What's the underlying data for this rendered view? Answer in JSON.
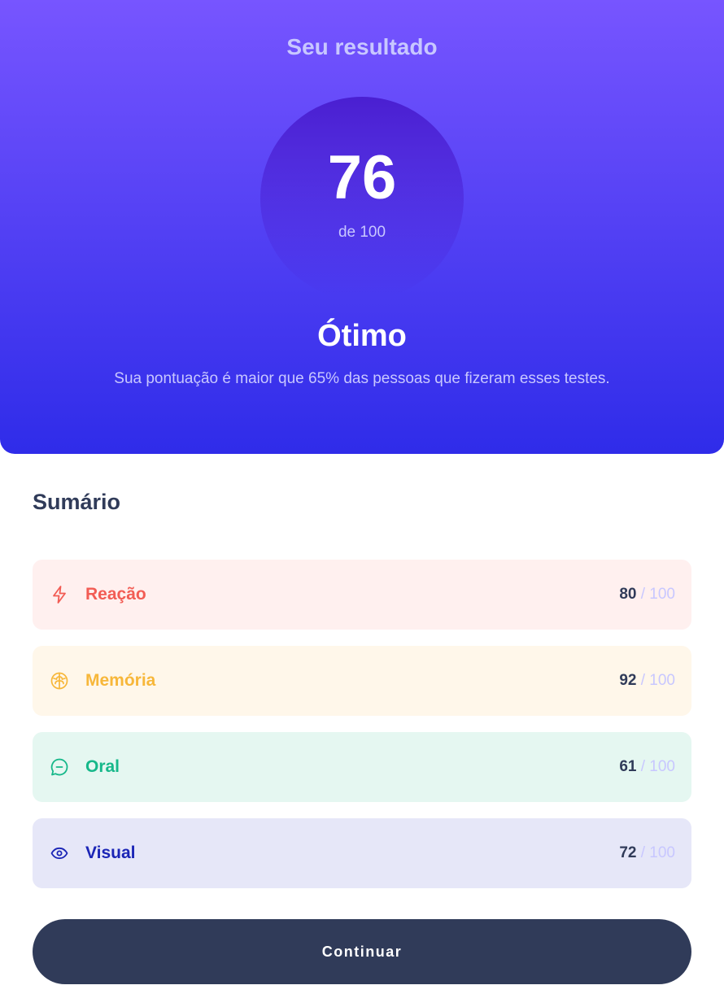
{
  "result": {
    "title": "Seu resultado",
    "score": "76",
    "max": "de 100",
    "grade": "Ótimo",
    "description": "Sua pontuação é maior que 65% das pessoas que fizeram esses testes."
  },
  "summary": {
    "title": "Sumário",
    "items": [
      {
        "label": "Reação",
        "score": "80",
        "separator": "/",
        "max": "100",
        "icon": "lightning-icon",
        "color": "#f25c54",
        "background": "#fff0ef"
      },
      {
        "label": "Memória",
        "score": "92",
        "separator": "/",
        "max": "100",
        "icon": "brain-icon",
        "color": "#f7b73a",
        "background": "#fff7ea"
      },
      {
        "label": "Oral",
        "score": "61",
        "separator": "/",
        "max": "100",
        "icon": "chat-bubble-icon",
        "color": "#16b88a",
        "background": "#e5f7f1"
      },
      {
        "label": "Visual",
        "score": "72",
        "separator": "/",
        "max": "100",
        "icon": "eye-icon",
        "color": "#1b25b6",
        "background": "#e6e7f8"
      }
    ]
  },
  "button": {
    "label": "Continuar"
  },
  "colors": {
    "gradient_top": "#7755ff",
    "gradient_bottom": "#2f2ce9",
    "accent_light": "#c8c7ff",
    "dark": "#303b59"
  }
}
